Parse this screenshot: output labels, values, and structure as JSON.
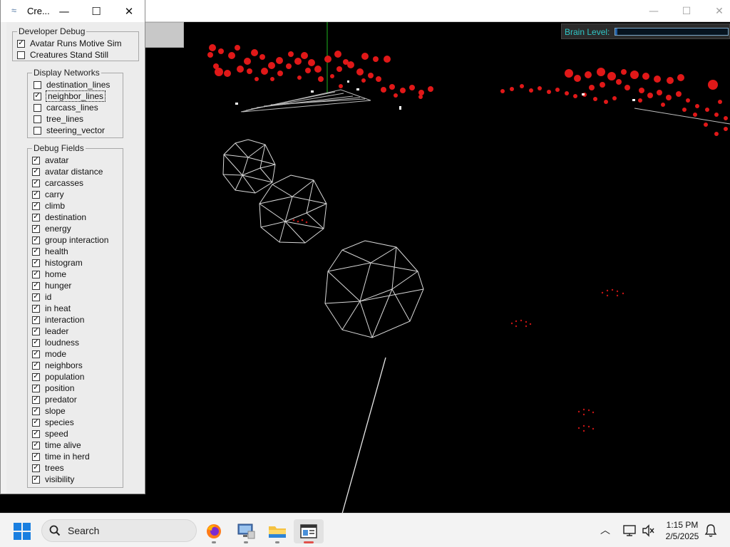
{
  "main_window": {
    "minimize_glyph": "—",
    "maximize_glyph": "☐",
    "close_glyph": "✕"
  },
  "brain_level": {
    "label": "Brain Level:",
    "fraction": 0.02,
    "fill_color": "#1e5aa0"
  },
  "debug_window": {
    "title": "Cre...",
    "title_icon": "app-icon",
    "minimize_glyph": "—",
    "maximize_glyph": "☐",
    "close_glyph": "✕",
    "developer_debug": {
      "title": "Developer Debug",
      "items": [
        {
          "label": "Avatar Runs Motive Sim",
          "checked": true
        },
        {
          "label": "Creatures Stand Still",
          "checked": false
        }
      ]
    },
    "display_networks": {
      "title": "Display Networks",
      "items": [
        {
          "label": "destination_lines",
          "checked": false
        },
        {
          "label": "neighbor_lines",
          "checked": true
        },
        {
          "label": "carcass_lines",
          "checked": false
        },
        {
          "label": "tree_lines",
          "checked": false
        },
        {
          "label": "steering_vector",
          "checked": false
        }
      ]
    },
    "debug_fields": {
      "title": "Debug Fields",
      "items": [
        {
          "label": "avatar",
          "checked": true
        },
        {
          "label": "avatar distance",
          "checked": true
        },
        {
          "label": "carcasses",
          "checked": true
        },
        {
          "label": "carry",
          "checked": true
        },
        {
          "label": "climb",
          "checked": true
        },
        {
          "label": "destination",
          "checked": true
        },
        {
          "label": "energy",
          "checked": true
        },
        {
          "label": "group interaction",
          "checked": true
        },
        {
          "label": "health",
          "checked": true
        },
        {
          "label": "histogram",
          "checked": true
        },
        {
          "label": "home",
          "checked": true
        },
        {
          "label": "hunger",
          "checked": true
        },
        {
          "label": "id",
          "checked": true
        },
        {
          "label": "in heat",
          "checked": true
        },
        {
          "label": "interaction",
          "checked": true
        },
        {
          "label": "leader",
          "checked": true
        },
        {
          "label": "loudness",
          "checked": true
        },
        {
          "label": "mode",
          "checked": true
        },
        {
          "label": "neighbors",
          "checked": true
        },
        {
          "label": "population",
          "checked": true
        },
        {
          "label": "position",
          "checked": true
        },
        {
          "label": "predator",
          "checked": true
        },
        {
          "label": "slope",
          "checked": true
        },
        {
          "label": "species",
          "checked": true
        },
        {
          "label": "speed",
          "checked": true
        },
        {
          "label": "time alive",
          "checked": true
        },
        {
          "label": "time in herd",
          "checked": true
        },
        {
          "label": "trees",
          "checked": true
        },
        {
          "label": "visibility",
          "checked": true
        }
      ]
    }
  },
  "taskbar": {
    "search_label": "Search",
    "apps": [
      "firefox-icon",
      "remote-desktop-icon",
      "file-explorer-icon",
      "creatures-app-icon"
    ],
    "time": "1:15 PM",
    "date": "2/5/2025"
  },
  "colors": {
    "particle_red": "#e01818",
    "accent_blue": "#1a7fe0",
    "brain_label": "#2fc6c6"
  }
}
